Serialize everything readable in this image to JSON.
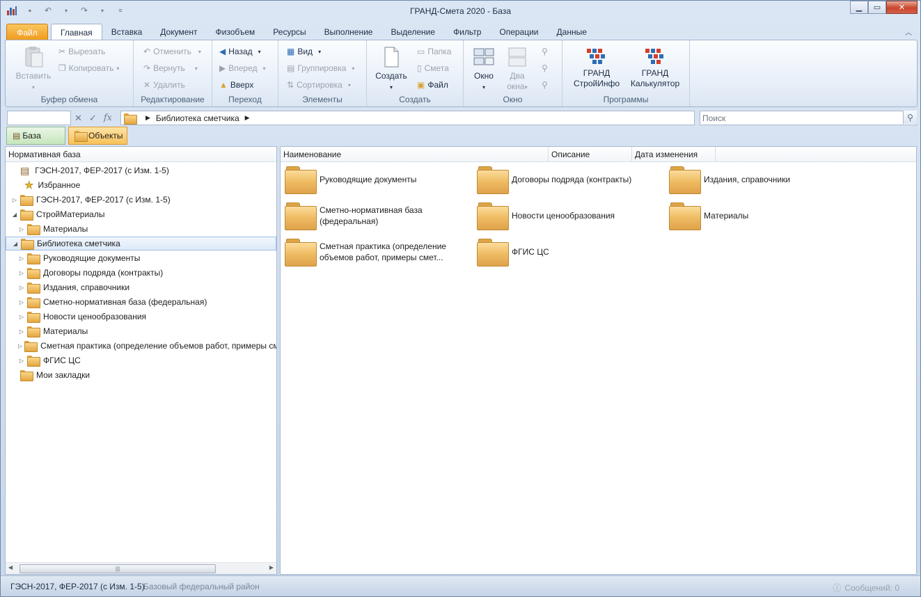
{
  "window": {
    "title": "ГРАНД-Смета 2020 - База"
  },
  "ribbon_tabs": [
    "Файл",
    "Главная",
    "Вставка",
    "Документ",
    "Физобъем",
    "Ресурсы",
    "Выполнение",
    "Выделение",
    "Фильтр",
    "Операции",
    "Данные"
  ],
  "active_tab": "Главная",
  "groups": {
    "clipboard": {
      "label": "Буфер обмена",
      "paste": "Вставить",
      "cut": "Вырезать",
      "copy": "Копировать"
    },
    "editing": {
      "label": "Редактирование",
      "undo": "Отменить",
      "redo": "Вернуть",
      "delete": "Удалить"
    },
    "navigation": {
      "label": "Переход",
      "back": "Назад",
      "forward": "Вперед",
      "up": "Вверх"
    },
    "elements": {
      "label": "Элементы",
      "view": "Вид",
      "group": "Группировка",
      "sort": "Сортировка"
    },
    "create": {
      "label": "Создать",
      "create": "Создать",
      "folder": "Папка",
      "estimate": "Смета",
      "file": "Файл"
    },
    "window_grp": {
      "label": "Окно",
      "window": "Окно",
      "two_windows_1": "Два",
      "two_windows_2": "окна"
    },
    "programs": {
      "label": "Программы",
      "grand_info_1": "ГРАНД",
      "grand_info_2": "СтройИнфо",
      "grand_calc_1": "ГРАНД",
      "grand_calc_2": "Калькулятор"
    }
  },
  "address": {
    "path": "Библиотека сметчика"
  },
  "search": {
    "placeholder": "Поиск"
  },
  "doc_tabs": {
    "base": "База",
    "objects": "Объекты"
  },
  "left_panel": {
    "header": "Нормативная база"
  },
  "tree": [
    {
      "label": "ГЭСН-2017, ФЕР-2017 (с Изм. 1-5)"
    },
    {
      "label": "Избранное"
    },
    {
      "label": "ГЭСН-2017, ФЕР-2017 (с Изм. 1-5)"
    },
    {
      "label": "СтройМатериалы"
    },
    {
      "label": "Материалы"
    },
    {
      "label": "Библиотека сметчика"
    },
    {
      "label": "Руководящие документы"
    },
    {
      "label": "Договоры подряда (контракты)"
    },
    {
      "label": "Издания, справочники"
    },
    {
      "label": "Сметно-нормативная база (федеральная)"
    },
    {
      "label": "Новости ценообразования"
    },
    {
      "label": "Материалы"
    },
    {
      "label": "Сметная практика (определение объемов работ, примеры смет)"
    },
    {
      "label": "ФГИС ЦС"
    },
    {
      "label": "Мои закладки"
    }
  ],
  "columns": [
    "Наименование",
    "Описание",
    "Дата изменения"
  ],
  "folders": [
    {
      "line1": "Руководящие документы",
      "line2": ""
    },
    {
      "line1": "Договоры подряда (контракты)",
      "line2": ""
    },
    {
      "line1": "Издания, справочники",
      "line2": ""
    },
    {
      "line1": "Сметно-нормативная база",
      "line2": "(федеральная)"
    },
    {
      "line1": "Новости ценообразования",
      "line2": ""
    },
    {
      "line1": "Материалы",
      "line2": ""
    },
    {
      "line1": "Сметная практика (определение",
      "line2": "объемов работ, примеры смет..."
    },
    {
      "line1": "ФГИС ЦС",
      "line2": ""
    }
  ],
  "status": {
    "left": "ГЭСН-2017, ФЕР-2017 (с Изм. 1-5)",
    "region": "Базовый федеральный район",
    "messages": "Сообщений: 0"
  }
}
